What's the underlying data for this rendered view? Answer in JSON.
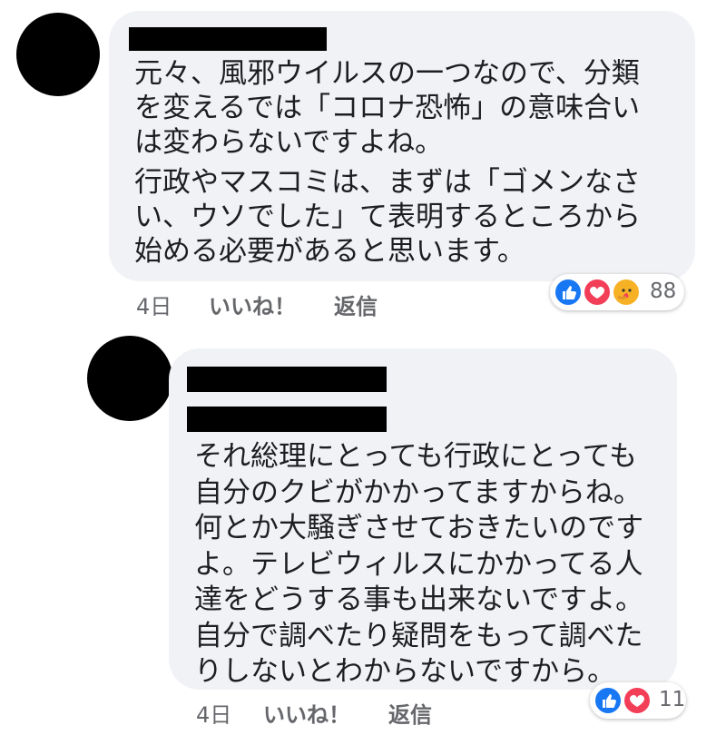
{
  "comments": [
    {
      "text_lines_1": [
        "元々、風邪ウイルスの一つなので、分類",
        "を変えるでは「コロナ恐怖」の意味合い",
        "は変わらないですよね。"
      ],
      "text_lines_2": [
        "行政やマスコミは、まずは「ゴメンなさ",
        "い、ウソでした」て表明するところから",
        "始める必要があると思います。"
      ],
      "time": "4日",
      "like_label": "いいね！",
      "reply_label": "返信",
      "reaction_count": "88",
      "reactions": [
        "like-icon",
        "love-icon",
        "care-icon"
      ]
    },
    {
      "text_lines": [
        "それ総理にとっても行政にとっても",
        "自分のクビがかかってますからね。",
        "何とか大騒ぎさせておきたいのです",
        "よ。テレビウィルスにかかってる人",
        "達をどうする事も出来ないですよ。",
        "自分で調べたり疑問をもって調べた",
        "りしないとわからないですから。"
      ],
      "time": "4日",
      "like_label": "いいね！",
      "reply_label": "返信",
      "reaction_count": "11",
      "reactions": [
        "like-icon",
        "love-icon"
      ]
    }
  ],
  "colors": {
    "bubble": "#f0f2f5",
    "like": "#1877f2",
    "love": "#f33e58",
    "care": "#f7b125",
    "meta": "#65676b"
  }
}
